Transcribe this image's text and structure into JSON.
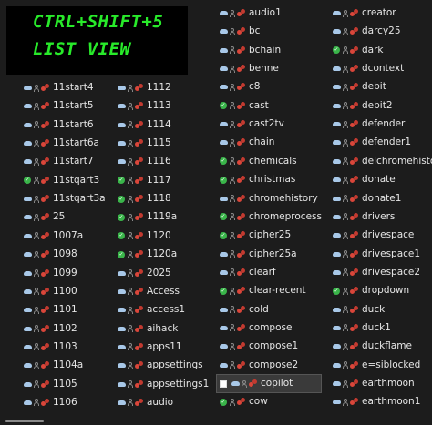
{
  "banner": {
    "line1": "CTRL+SHIFT+5",
    "line2": "LIST VIEW"
  },
  "columns": [
    {
      "items": [
        {
          "name": "11start4",
          "status": "cloud"
        },
        {
          "name": "11start5",
          "status": "cloud"
        },
        {
          "name": "11start6",
          "status": "cloud"
        },
        {
          "name": "11start6a",
          "status": "cloud"
        },
        {
          "name": "11start7",
          "status": "cloud"
        },
        {
          "name": "11stqart3",
          "status": "check"
        },
        {
          "name": "11stqart3a",
          "status": "cloud"
        },
        {
          "name": "25",
          "status": "cloud"
        },
        {
          "name": "1007a",
          "status": "cloud"
        },
        {
          "name": "1098",
          "status": "cloud"
        },
        {
          "name": "1099",
          "status": "cloud"
        },
        {
          "name": "1100",
          "status": "cloud"
        },
        {
          "name": "1101",
          "status": "cloud"
        },
        {
          "name": "1102",
          "status": "cloud"
        },
        {
          "name": "1103",
          "status": "cloud"
        },
        {
          "name": "1104a",
          "status": "cloud"
        },
        {
          "name": "1105",
          "status": "cloud"
        },
        {
          "name": "1106",
          "status": "cloud"
        }
      ]
    },
    {
      "items": [
        {
          "name": "1112",
          "status": "cloud"
        },
        {
          "name": "1113",
          "status": "cloud"
        },
        {
          "name": "1114",
          "status": "cloud"
        },
        {
          "name": "1115",
          "status": "cloud"
        },
        {
          "name": "1116",
          "status": "cloud"
        },
        {
          "name": "1117",
          "status": "check"
        },
        {
          "name": "1118",
          "status": "check"
        },
        {
          "name": "1119a",
          "status": "check"
        },
        {
          "name": "1120",
          "status": "check"
        },
        {
          "name": "1120a",
          "status": "check"
        },
        {
          "name": "2025",
          "status": "cloud"
        },
        {
          "name": "Access",
          "status": "cloud"
        },
        {
          "name": "access1",
          "status": "cloud"
        },
        {
          "name": "aihack",
          "status": "cloud"
        },
        {
          "name": "apps11",
          "status": "cloud"
        },
        {
          "name": "appsettings",
          "status": "cloud"
        },
        {
          "name": "appsettings1",
          "status": "cloud"
        },
        {
          "name": "audio",
          "status": "cloud"
        }
      ]
    },
    {
      "items": [
        {
          "name": "audio1",
          "status": "cloud"
        },
        {
          "name": "bc",
          "status": "cloud"
        },
        {
          "name": "bchain",
          "status": "cloud"
        },
        {
          "name": "benne",
          "status": "cloud"
        },
        {
          "name": "c8",
          "status": "cloud"
        },
        {
          "name": "cast",
          "status": "check"
        },
        {
          "name": "cast2tv",
          "status": "cloud"
        },
        {
          "name": "chain",
          "status": "cloud"
        },
        {
          "name": "chemicals",
          "status": "check"
        },
        {
          "name": "christmas",
          "status": "check"
        },
        {
          "name": "chromehistory",
          "status": "cloud"
        },
        {
          "name": "chromeprocess",
          "status": "check"
        },
        {
          "name": "cipher25",
          "status": "check"
        },
        {
          "name": "cipher25a",
          "status": "cloud"
        },
        {
          "name": "clearf",
          "status": "cloud"
        },
        {
          "name": "clear-recent",
          "status": "check"
        },
        {
          "name": "cold",
          "status": "cloud"
        },
        {
          "name": "compose",
          "status": "cloud"
        },
        {
          "name": "compose1",
          "status": "cloud"
        },
        {
          "name": "compose2",
          "status": "cloud"
        },
        {
          "name": "copilot",
          "status": "cloud",
          "selected": true
        },
        {
          "name": "cow",
          "status": "check"
        }
      ]
    },
    {
      "items": [
        {
          "name": "creator",
          "status": "cloud"
        },
        {
          "name": "darcy25",
          "status": "cloud"
        },
        {
          "name": "dark",
          "status": "check"
        },
        {
          "name": "dcontext",
          "status": "cloud"
        },
        {
          "name": "debit",
          "status": "cloud"
        },
        {
          "name": "debit2",
          "status": "cloud"
        },
        {
          "name": "defender",
          "status": "cloud"
        },
        {
          "name": "defender1",
          "status": "cloud"
        },
        {
          "name": "delchromehistory",
          "status": "cloud"
        },
        {
          "name": "donate",
          "status": "cloud"
        },
        {
          "name": "donate1",
          "status": "cloud"
        },
        {
          "name": "drivers",
          "status": "cloud"
        },
        {
          "name": "drivespace",
          "status": "cloud"
        },
        {
          "name": "drivespace1",
          "status": "cloud"
        },
        {
          "name": "drivespace2",
          "status": "cloud"
        },
        {
          "name": "dropdown",
          "status": "check"
        },
        {
          "name": "duck",
          "status": "cloud"
        },
        {
          "name": "duck1",
          "status": "cloud"
        },
        {
          "name": "duckflame",
          "status": "cloud"
        },
        {
          "name": "e=siblocked",
          "status": "cloud"
        },
        {
          "name": "earthmoon",
          "status": "cloud"
        },
        {
          "name": "earthmoon1",
          "status": "cloud"
        }
      ]
    }
  ]
}
